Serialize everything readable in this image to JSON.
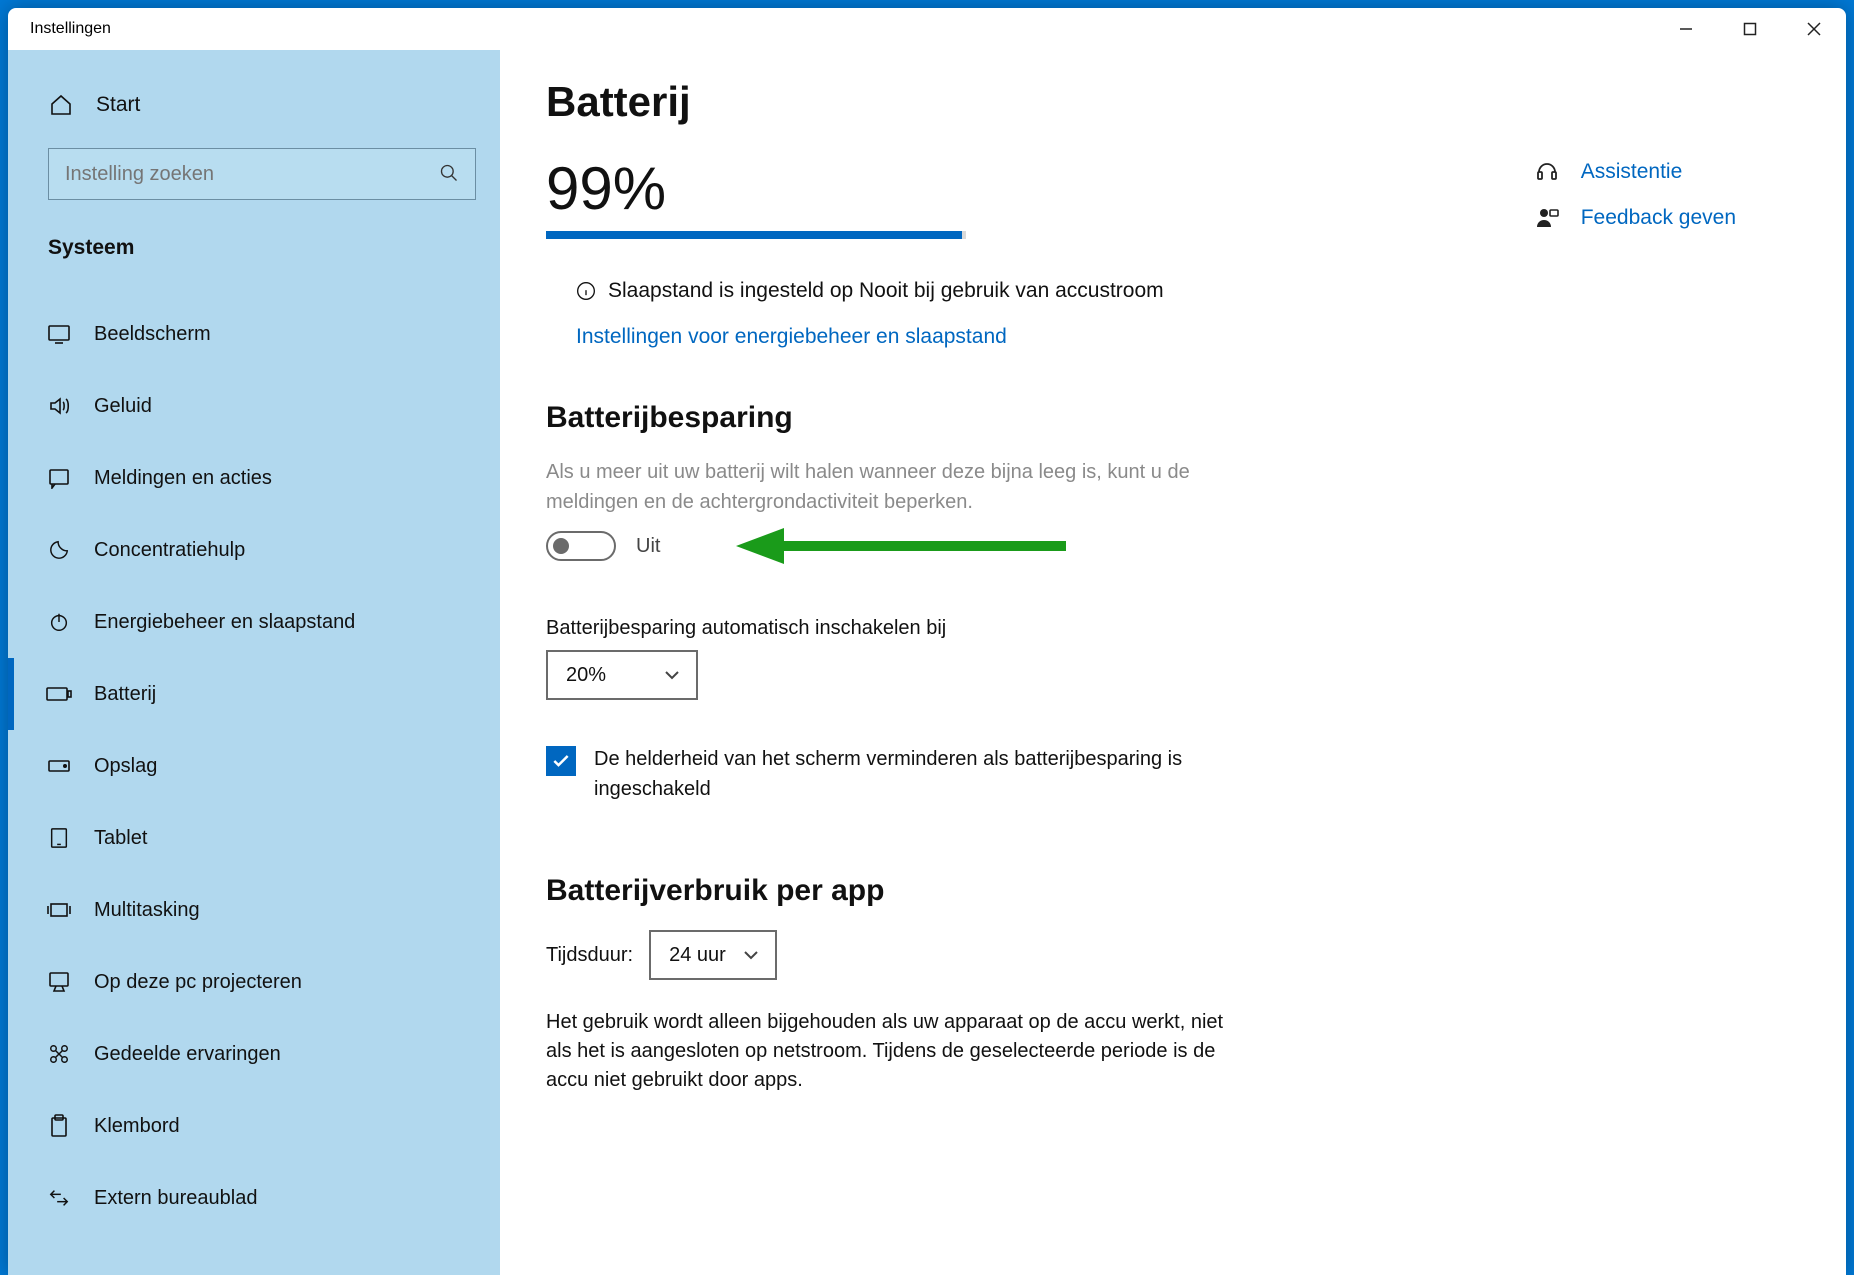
{
  "window": {
    "title": "Instellingen"
  },
  "home_label": "Start",
  "search": {
    "placeholder": "Instelling zoeken"
  },
  "category": "Systeem",
  "nav": [
    {
      "id": "display",
      "label": "Beeldscherm"
    },
    {
      "id": "sound",
      "label": "Geluid"
    },
    {
      "id": "notifications",
      "label": "Meldingen en acties"
    },
    {
      "id": "focus",
      "label": "Concentratiehulp"
    },
    {
      "id": "power",
      "label": "Energiebeheer en slaapstand"
    },
    {
      "id": "battery",
      "label": "Batterij"
    },
    {
      "id": "storage",
      "label": "Opslag"
    },
    {
      "id": "tablet",
      "label": "Tablet"
    },
    {
      "id": "multitasking",
      "label": "Multitasking"
    },
    {
      "id": "projecting",
      "label": "Op deze pc projecteren"
    },
    {
      "id": "shared",
      "label": "Gedeelde ervaringen"
    },
    {
      "id": "clipboard",
      "label": "Klembord"
    },
    {
      "id": "remote",
      "label": "Extern bureaublad"
    }
  ],
  "page": {
    "title": "Batterij",
    "percent": "99%",
    "sleep_info": "Slaapstand is ingesteld op Nooit bij gebruik van accustroom",
    "power_link": "Instellingen voor energiebeheer en slaapstand",
    "saver": {
      "title": "Batterijbesparing",
      "desc": "Als u meer uit uw batterij wilt halen wanneer deze bijna leeg is, kunt u de meldingen en de achtergrondactiviteit beperken.",
      "toggle_state": "Uit",
      "auto_label": "Batterijbesparing automatisch inschakelen bij",
      "auto_value": "20%",
      "brightness_label": "De helderheid van het scherm verminderen als batterijbesparing is ingeschakeld"
    },
    "usage": {
      "title": "Batterijverbruik per app",
      "duration_label": "Tijdsduur:",
      "duration_value": "24 uur",
      "desc": "Het gebruik wordt alleen bijgehouden als uw apparaat op de accu werkt, niet als het is aangesloten op netstroom. Tijdens de geselecteerde periode is de accu niet gebruikt door apps."
    }
  },
  "right": {
    "assist": "Assistentie",
    "feedback": "Feedback geven"
  }
}
